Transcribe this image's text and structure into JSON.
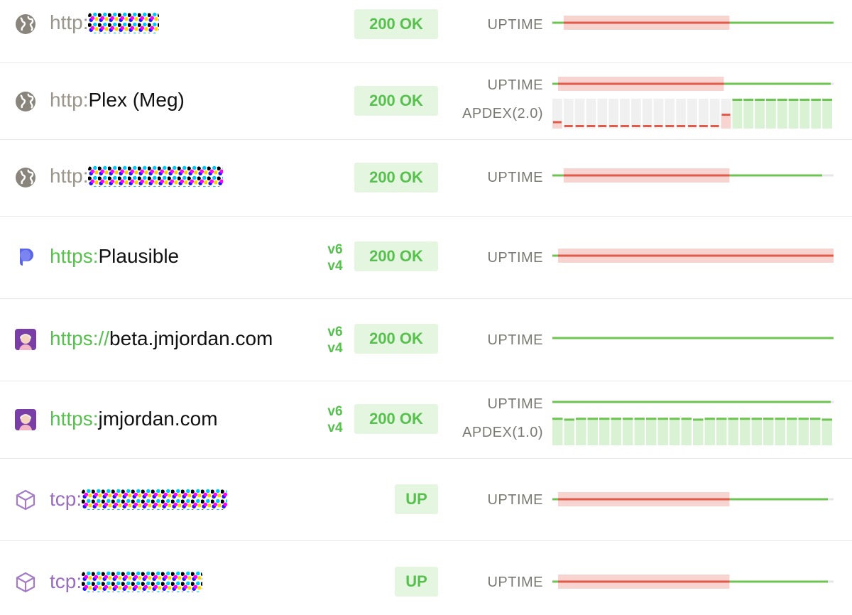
{
  "colors": {
    "green": "#58c04f",
    "green_line": "#6cc551",
    "green_fill": "#d9f2d3",
    "red_line": "#e15a4a",
    "red_fill": "#f8d4d0",
    "gray_fill": "#f0f0f0",
    "http_scheme": "#9b968c",
    "https_scheme": "#58c04f",
    "tcp_scheme": "#9a6cc0",
    "status_bg": "#e4f6e0"
  },
  "labels": {
    "uptime": "UPTIME"
  },
  "monitors": [
    {
      "icon": "globe-icon",
      "scheme": "http:",
      "host": "",
      "host_redacted": true,
      "ip_versions": [],
      "status": "200 OK",
      "uptime": {
        "outage_start": 0.04,
        "outage_end": 0.63,
        "line_end": 1.0
      },
      "apdex": null
    },
    {
      "icon": "globe-icon",
      "scheme": "http: ",
      "host": "Plex (Meg)",
      "host_redacted": false,
      "ip_versions": [],
      "status": "200 OK",
      "uptime": {
        "outage_start": 0.02,
        "outage_end": 0.61,
        "line_end": 0.99
      },
      "apdex": {
        "label": "APDEX(2.0)",
        "bars": [
          0.25,
          0.0,
          0.0,
          0.0,
          0.0,
          0.0,
          0.0,
          0.0,
          0.0,
          0.0,
          0.0,
          0.0,
          0.0,
          0.0,
          0.0,
          0.5,
          1.0,
          1.0,
          1.0,
          1.0,
          1.0,
          1.0,
          1.0,
          1.0,
          1.0
        ]
      }
    },
    {
      "icon": "globe-icon",
      "scheme": "http:",
      "host": "",
      "host_redacted": true,
      "ip_versions": [],
      "status": "200 OK",
      "uptime": {
        "outage_start": 0.04,
        "outage_end": 0.63,
        "line_end": 0.96
      },
      "apdex": null
    },
    {
      "icon": "plausible-logo-icon",
      "scheme": "https: ",
      "host": "Plausible",
      "host_redacted": false,
      "ip_versions": [
        "v6",
        "v4"
      ],
      "status": "200 OK",
      "uptime": {
        "outage_start": 0.02,
        "outage_end": 1.0,
        "line_end": 1.0
      },
      "apdex": null
    },
    {
      "icon": "avatar-icon",
      "scheme": "https://",
      "host": "beta.jmjordan.com",
      "host_redacted": false,
      "ip_versions": [
        "v6",
        "v4"
      ],
      "status": "200 OK",
      "uptime": {
        "outage_start": 0,
        "outage_end": 0,
        "line_end": 1.0
      },
      "apdex": null
    },
    {
      "icon": "avatar-icon",
      "scheme": "https: ",
      "host": "jmjordan.com",
      "host_redacted": false,
      "ip_versions": [
        "v6",
        "v4"
      ],
      "status": "200 OK",
      "uptime": {
        "outage_start": 0,
        "outage_end": 0,
        "line_end": 0.99
      },
      "apdex": {
        "label": "APDEX(1.0)",
        "bars": [
          0.97,
          0.94,
          0.97,
          0.97,
          0.97,
          0.97,
          0.97,
          0.97,
          0.97,
          0.97,
          0.97,
          0.97,
          0.94,
          0.97,
          0.97,
          0.97,
          0.97,
          0.97,
          0.97,
          0.97,
          0.97,
          0.97,
          0.97,
          0.94
        ]
      }
    },
    {
      "icon": "cube-icon",
      "scheme": "tcp:",
      "host": "",
      "host_redacted": true,
      "ip_versions": [],
      "status": "UP",
      "uptime": {
        "outage_start": 0.02,
        "outage_end": 0.63,
        "line_end": 0.98
      },
      "apdex": null
    },
    {
      "icon": "cube-icon",
      "scheme": "tcp:",
      "host": "",
      "host_redacted": true,
      "ip_versions": [],
      "status": "UP",
      "uptime": {
        "outage_start": 0.02,
        "outage_end": 0.63,
        "line_end": 0.98
      },
      "apdex": null
    }
  ]
}
